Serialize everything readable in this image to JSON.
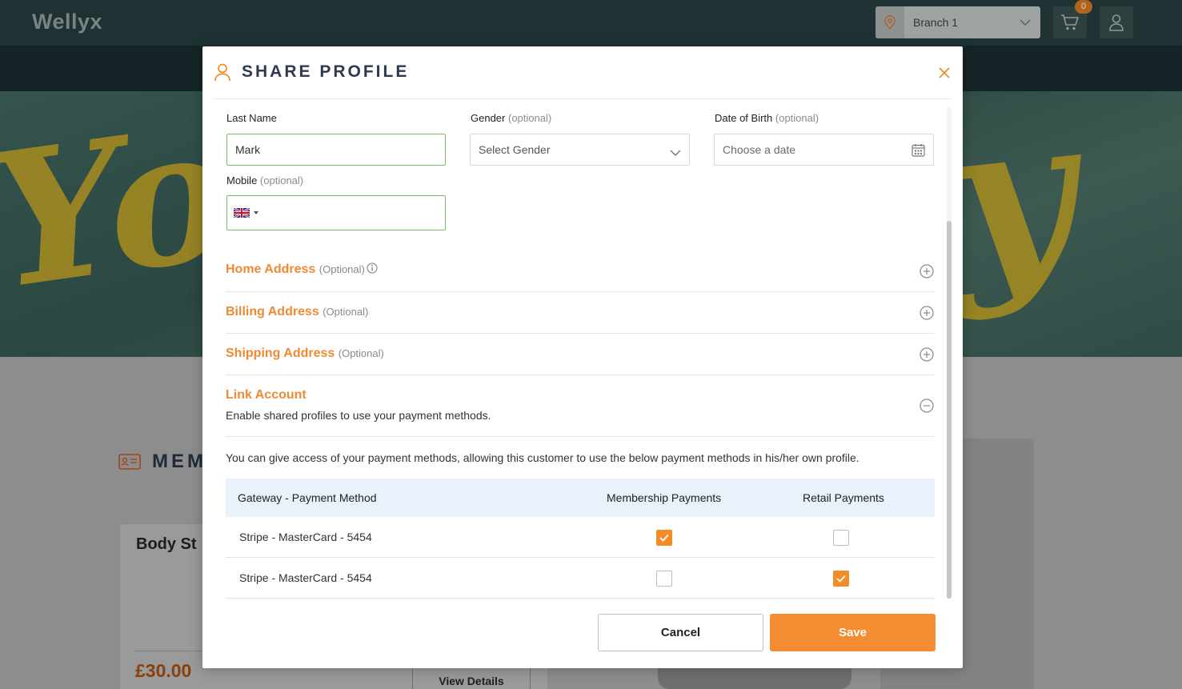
{
  "app": {
    "logo": "Wellyx",
    "branch": "Branch 1",
    "cart_count": "0"
  },
  "background": {
    "membership_heading": "MEM",
    "card_title": "Body St",
    "card_price": "£30.00",
    "view_details": "View Details"
  },
  "modal": {
    "title": "SHARE PROFILE",
    "fields": {
      "last_name": {
        "label": "Last Name",
        "value": "Mark"
      },
      "gender": {
        "label": "Gender",
        "optional": "(optional)",
        "placeholder": "Select Gender"
      },
      "dob": {
        "label": "Date of Birth",
        "optional": "(optional)",
        "placeholder": "Choose a date"
      },
      "mobile": {
        "label": "Mobile",
        "optional": "(optional)",
        "value": ""
      }
    },
    "sections": {
      "home": {
        "title": "Home Address",
        "optional": "(Optional)"
      },
      "billing": {
        "title": "Billing Address",
        "optional": "(Optional)"
      },
      "shipping": {
        "title": "Shipping Address",
        "optional": "(Optional)"
      },
      "link": {
        "title": "Link Account",
        "description": "Enable shared profiles to use your payment methods."
      }
    },
    "info_text": "You can give access of your payment methods, allowing this customer to use the below payment methods in his/her own profile.",
    "table": {
      "headers": [
        "Gateway - Payment Method",
        "Membership Payments",
        "Retail Payments"
      ],
      "rows": [
        {
          "method": "Stripe - MasterCard - 5454",
          "membership": true,
          "retail": false
        },
        {
          "method": "Stripe - MasterCard - 5454",
          "membership": false,
          "retail": true
        }
      ]
    },
    "buttons": {
      "cancel": "Cancel",
      "save": "Save"
    }
  },
  "colors": {
    "accent": "#f58c31",
    "title": "#2e3a4d",
    "input_valid_border": "#7bbd6b",
    "table_header_bg": "#e9f1fb"
  }
}
